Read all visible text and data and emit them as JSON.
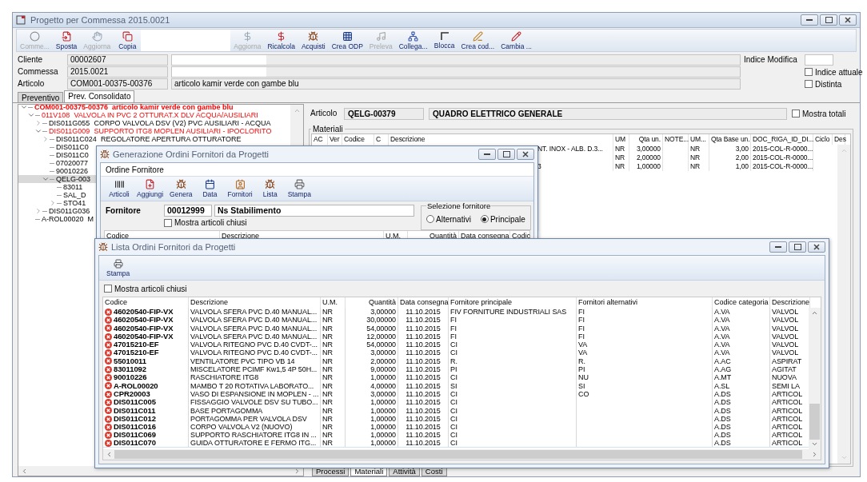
{
  "main_window": {
    "title": "Progetto per Commessa 2015.0021",
    "toolbar": [
      {
        "buttons": [
          {
            "label": "Comme...",
            "disabled": true
          },
          {
            "label": "Sposta",
            "disabled": false
          },
          {
            "label": "Aggiorna",
            "disabled": true
          },
          {
            "label": "Copia",
            "disabled": false
          }
        ]
      },
      {
        "buttons": [
          {
            "label": "Aggiorna",
            "disabled": true
          },
          {
            "label": "Ricalcola",
            "disabled": false
          },
          {
            "label": "Acquisti",
            "disabled": false
          },
          {
            "label": "Crea ODP",
            "disabled": false
          },
          {
            "label": "Preleva",
            "disabled": true
          },
          {
            "label": "Collega...",
            "disabled": false
          },
          {
            "label": "Blocca",
            "disabled": false
          },
          {
            "label": "Crea cod...",
            "disabled": false
          },
          {
            "label": "Cambia ...",
            "disabled": false
          }
        ]
      }
    ]
  },
  "header": {
    "fields": [
      {
        "label": "Cliente",
        "code": "00002607",
        "redacted": true
      },
      {
        "label": "Commessa",
        "code": "2015.0021",
        "redacted": true
      },
      {
        "label": "Articolo",
        "code": "COM001-00375-00376",
        "redacted": false,
        "description": "articolo kamir verde con gambe blu"
      }
    ],
    "revision_label": "Indice Modifica",
    "options": [
      {
        "label": "Indice attuale",
        "checked": false
      },
      {
        "label": "Distinta",
        "checked": false
      }
    ]
  },
  "tabs": [
    {
      "label": "Preventivo",
      "selected": false
    },
    {
      "label": "Prev. Consolidato",
      "selected": true
    }
  ],
  "tree": [
    {
      "code": "COM001-00375-00376",
      "text": "articolo kamir verde con gambe blu",
      "highlighted": true,
      "expanded": true,
      "selected": false,
      "children": [
        {
          "code": "011V108",
          "text": "VALVOLA IN PVC 2 OTTURAT.X DLV ACQUA/AUSILIARI",
          "highlighted": true,
          "expanded": true,
          "selected": false,
          "children": [
            {
              "code": "DIS011G055",
              "text": "CORPO VALVOLA DSV (V2) PVC AUSILIARI - ACQUA",
              "highlighted": false,
              "expanded": false,
              "selected": false
            },
            {
              "code": "DIS011G009",
              "text": "SUPPORTO ITG8 MOPLEN AUSILIARI - IPOCLORITO",
              "highlighted": true,
              "expanded": true,
              "selected": false,
              "children": [
                {
                  "code": "DIS011C024",
                  "text": "REGOLATORE APERTURA OTTURATORE",
                  "highlighted": false,
                  "expanded": false,
                  "selected": false
                },
                {
                  "code": "DIS011C0",
                  "highlighted": false,
                  "selected": false
                },
                {
                  "code": "DIS011C0",
                  "highlighted": false,
                  "selected": false
                },
                {
                  "code": "07020077",
                  "highlighted": false,
                  "selected": false
                },
                {
                  "code": "90010226",
                  "highlighted": false,
                  "selected": false
                },
                {
                  "code": "QELG-003",
                  "highlighted": false,
                  "expanded": true,
                  "selected": true,
                  "children": [
                    {
                      "code": "83011",
                      "highlighted": false,
                      "selected": false
                    },
                    {
                      "code": "SAL_D",
                      "highlighted": false,
                      "selected": false
                    },
                    {
                      "code": "STO41",
                      "highlighted": false,
                      "expanded": false,
                      "selected": false
                    }
                  ]
                }
              ]
            },
            {
              "code": "DIS011G036",
              "highlighted": false,
              "expanded": false,
              "selected": false
            }
          ]
        },
        {
          "code": "A-ROL00020",
          "text": "M",
          "highlighted": false,
          "selected": false
        }
      ]
    }
  ],
  "detail": {
    "label": "Articolo",
    "code": "QELG-00379",
    "description": "QUADRO ELETTRICO GENERALE",
    "show_totals": {
      "label": "Mostra totali",
      "checked": false
    },
    "group_title": "Materiali",
    "columns": [
      "AC",
      "Ver",
      "Codice",
      "C",
      "Descrizione",
      "UM",
      "Qta un.",
      "NOTE...",
      "UM...",
      "Qta Base un.",
      "DOC_RIGA_ID_DI...",
      "Ciclo",
      "Des"
    ],
    "rows": [
      {
        "description": "NT. INOX - ALB. D.3...",
        "um": "NR",
        "qty": "3,00000",
        "um_base": "NR",
        "qty_base": "3,00",
        "doc": "2015-COL-R-0000..."
      },
      {
        "um": "NR",
        "qty": "2,00000",
        "um_base": "NR",
        "qty_base": "2,00",
        "doc": "2015-COL-R-0000..."
      },
      {
        "description": "3",
        "um": "NR",
        "qty": "1,00000",
        "um_base": "NR",
        "qty_base": "1,00",
        "doc": "2015-COL-R-0000..."
      }
    ]
  },
  "bottom_tabs": [
    {
      "label": "Processi",
      "selected": false
    },
    {
      "label": "Materiali",
      "selected": true
    },
    {
      "label": "Attività",
      "selected": false
    },
    {
      "label": "Costi",
      "selected": false
    }
  ],
  "dialog_genera": {
    "title": "Generazione Ordini Fornitori da Progetti",
    "menu": [
      "Ordine Fornitore"
    ],
    "toolbar": [
      "Articoli",
      "Aggiungi",
      "Genera",
      "Data",
      "Fornitori",
      "Lista",
      "Stampa"
    ],
    "supplier": {
      "label": "Fornitore",
      "code": "00012999",
      "name": "Ns Stabilimento"
    },
    "show_closed": {
      "label": "Mostra articoli chiusi",
      "checked": false
    },
    "supplier_selection": {
      "title": "Selezione fornitore",
      "options": [
        {
          "label": "Alternativi",
          "selected": false
        },
        {
          "label": "Principale",
          "selected": true
        }
      ]
    },
    "columns": [
      "Codice",
      "Descrizione",
      "U.M.",
      "Quantità",
      "Data consegna",
      "Codic"
    ]
  },
  "dialog_lista": {
    "title": "Lista Ordini Fornitori da Progetti",
    "toolbar": [
      "Stampa"
    ],
    "show_closed": {
      "label": "Mostra articoli chiusi",
      "checked": false
    },
    "columns": [
      "Codice",
      "Descrizione",
      "U.M.",
      "Quantità",
      "Data consegna",
      "Fornitore principale",
      "Fornitori alternativi",
      "Codice categoria",
      "Descrizione"
    ],
    "rows": [
      {
        "code": "46020540-FIP-VX",
        "description": "VALVOLA SFERA PVC D.40 MANUAL...",
        "um": "NR",
        "qty": "3,00000",
        "date": "11.10.2015",
        "main_supplier": "FIV FORNITURE INDUSTRIALI SAS",
        "alt_suppliers": "FI",
        "category": "A.VA",
        "category_description": "VALVOL"
      },
      {
        "code": "46020540-FIP-VX",
        "description": "VALVOLA SFERA PVC D.40 MANUAL...",
        "um": "NR",
        "qty": "30,00000",
        "date": "11.10.2015",
        "main_supplier": "FI",
        "alt_suppliers": "FI",
        "category": "A.VA",
        "category_description": "VALVOL"
      },
      {
        "code": "46020540-FIP-VX",
        "description": "VALVOLA SFERA PVC D.40 MANUAL...",
        "um": "NR",
        "qty": "54,00000",
        "date": "11.10.2015",
        "main_supplier": "FI",
        "alt_suppliers": "FI",
        "category": "A.VA",
        "category_description": "VALVOL"
      },
      {
        "code": "46020540-FIP-VX",
        "description": "VALVOLA SFERA PVC D.40 MANUAL...",
        "um": "NR",
        "qty": "12,00000",
        "date": "11.10.2015",
        "main_supplier": "FI",
        "alt_suppliers": "FI",
        "category": "A.VA",
        "category_description": "VALVOL"
      },
      {
        "code": "47015210-EF",
        "description": "VALVOLA RITEGNO PVC D.40 CVDT-...",
        "um": "NR",
        "qty": "54,00000",
        "date": "11.10.2015",
        "main_supplier": "CI",
        "alt_suppliers": "VA",
        "category": "A.VA",
        "category_description": "VALVOL"
      },
      {
        "code": "47015210-EF",
        "description": "VALVOLA RITEGNO PVC D.40 CVDT-...",
        "um": "NR",
        "qty": "3,00000",
        "date": "11.10.2015",
        "main_supplier": "CI",
        "alt_suppliers": "VA",
        "category": "A.VA",
        "category_description": "VALVOL"
      },
      {
        "code": "55010011",
        "description": "VENTILATORE PVC TIPO VB 14",
        "um": "NR",
        "qty": "2,00000",
        "date": "11.10.2015",
        "main_supplier": "R.",
        "alt_suppliers": "R.",
        "category": "A.AC",
        "category_description": "ASPIRAT"
      },
      {
        "code": "83011092",
        "description": "MISCELATORE PCIMF Kw1,5 4P 50H...",
        "um": "NR",
        "qty": "9,00000",
        "date": "11.10.2015",
        "main_supplier": "PI",
        "alt_suppliers": "PI",
        "category": "A.AG",
        "category_description": "AGITAT"
      },
      {
        "code": "90010226",
        "description": "RASCHIATORE ITG8",
        "um": "NR",
        "qty": "1,00000",
        "date": "11.10.2015",
        "main_supplier": "CI",
        "alt_suppliers": "NU",
        "category": "A.MT",
        "category_description": "NUOVA"
      },
      {
        "code": "A-ROL00020",
        "description": "MAMBO T 20 ROTATIVA LABORATO...",
        "um": "NR",
        "qty": "4,00000",
        "date": "11.10.2015",
        "main_supplier": "SI",
        "alt_suppliers": "SI",
        "category": "A.SL",
        "category_description": "SEMI LA"
      },
      {
        "code": "CPR20003",
        "description": "VASO DI ESPANSIONE IN MOPLEN - ...",
        "um": "NR",
        "qty": "3,00000",
        "date": "11.10.2015",
        "main_supplier": "CI",
        "alt_suppliers": "CO",
        "category": "A.DS",
        "category_description": "ARTICOL"
      },
      {
        "code": "DIS011C005",
        "description": "FISSAGGIO VALVOLE DSV SU TUBO...",
        "um": "NR",
        "qty": "1,00000",
        "date": "11.10.2015",
        "main_supplier": "CI",
        "category": "A.DS",
        "category_description": "ARTICOL"
      },
      {
        "code": "DIS011C011",
        "description": "BASE PORTAGOMMA",
        "um": "NR",
        "qty": "1,00000",
        "date": "11.10.2015",
        "main_supplier": "CI",
        "category": "A.DS",
        "category_description": "ARTICOL"
      },
      {
        "code": "DIS011C012",
        "description": "PORTAGOMMA PER VALVOLA DSV",
        "um": "NR",
        "qty": "1,00000",
        "date": "11.10.2015",
        "main_supplier": "CI",
        "category": "A.DS",
        "category_description": "ARTICOL"
      },
      {
        "code": "DIS011C016",
        "description": "CORPO VALVOLA V2 (NUOVO)",
        "um": "NR",
        "qty": "1,00000",
        "date": "11.10.2015",
        "main_supplier": "CI",
        "category": "A.DS",
        "category_description": "ARTICOL"
      },
      {
        "code": "DIS011C069",
        "description": "SUPPORTO RASCHIATORE ITG8 IN ...",
        "um": "NR",
        "qty": "1,00000",
        "date": "11.10.2015",
        "main_supplier": "CI",
        "category": "A.DS",
        "category_description": "ARTICOL"
      },
      {
        "code": "DIS011C070",
        "description": "GUIDA OTTURATORE E FERMO ITG...",
        "um": "NR",
        "qty": "1,00000",
        "date": "11.10.2015",
        "main_supplier": "CI",
        "category": "A.DS",
        "category_description": "ARTICOL"
      }
    ]
  }
}
